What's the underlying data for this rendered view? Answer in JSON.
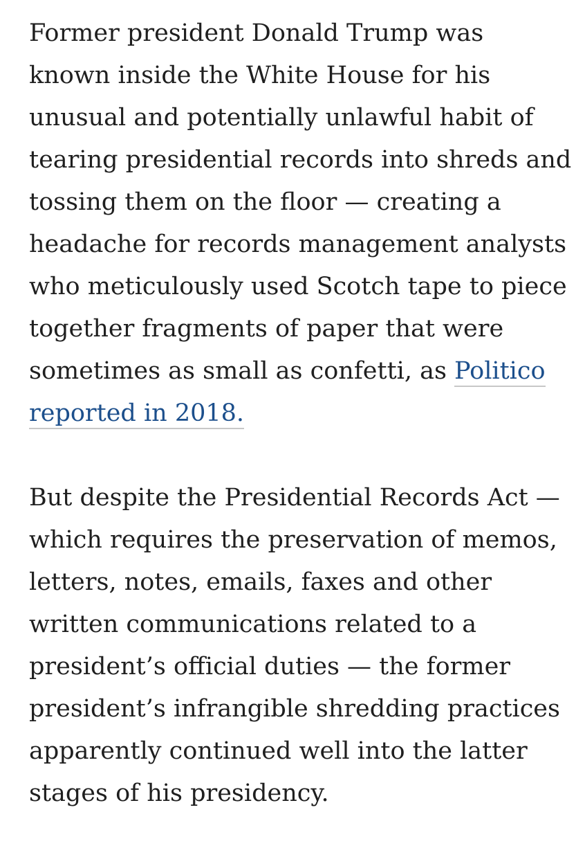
{
  "article": {
    "paragraph1": {
      "lines": [
        "Former president Donald Trump was",
        "known inside the White House for his",
        "unusual and potentially unlawful habit of",
        "tearing presidential records into shreds and",
        "tossing them on the floor — creating a",
        "headache for records management analysts",
        "who meticulously used Scotch tape to piece",
        "together fragments of paper that were"
      ],
      "line9_text": "sometimes as small as confetti, as ",
      "link_part1": "Politico",
      "link_part2": "reported in 2018."
    },
    "paragraph2": {
      "lines": [
        "But despite the Presidential Records Act —",
        "which requires the preservation of memos,",
        "letters, notes, emails, faxes and other",
        "written communications related to a",
        "president’s official duties — the former",
        "president’s infrangible shredding practices",
        "apparently continued well into the latter",
        "stages of his presidency."
      ]
    },
    "colors": {
      "text": "#1f1f1f",
      "link": "#1c4f8c",
      "link_underline": "#c7c7c7",
      "background": "#ffffff"
    }
  }
}
